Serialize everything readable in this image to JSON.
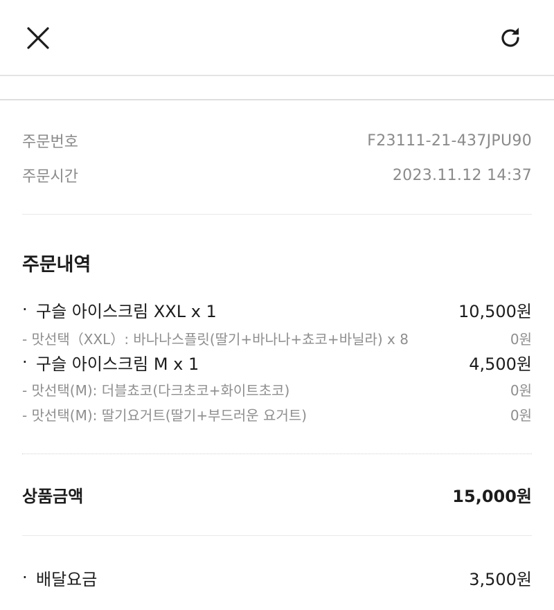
{
  "header": {
    "close_icon": "close-icon",
    "refresh_icon": "refresh-icon"
  },
  "order_info": {
    "number_label": "주문번호",
    "number_value": "F23111-21-437JPU90",
    "time_label": "주문시간",
    "time_value": "2023.11.12 14:37"
  },
  "order_details": {
    "title": "주문내역",
    "bullet": "·",
    "items": [
      {
        "name": "구슬 아이스크림 XXL x 1",
        "price": "10,500원",
        "options": [
          {
            "text": "- 맛선택（XXL）: 바나나스플릿(딸기+바나나+쵸코+바닐라) x 8",
            "price": "0원"
          }
        ]
      },
      {
        "name": "구슬 아이스크림 M x 1",
        "price": "4,500원",
        "options": [
          {
            "text": "- 맛선택(M): 더블쵸코(다크초코+화이트초코)",
            "price": "0원"
          },
          {
            "text": "- 맛선택(M): 딸기요거트(딸기+부드러운 요거트)",
            "price": "0원"
          }
        ]
      }
    ]
  },
  "summary": {
    "product_total_label": "상품금액",
    "product_total_value": "15,000원",
    "delivery_bullet": "·",
    "delivery_label": "배달요금",
    "delivery_value": "3,500원"
  }
}
